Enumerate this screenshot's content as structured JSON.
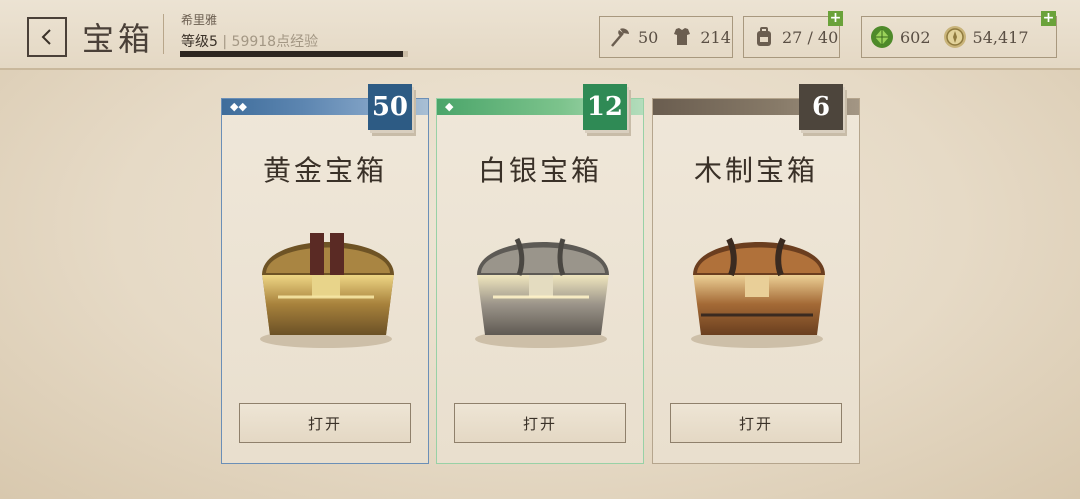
{
  "header": {
    "title": "宝箱",
    "player_name": "希里雅",
    "level": "等级5",
    "xp_text": "59918点经验",
    "xp_progress": 0.98
  },
  "resources": {
    "attack": "50",
    "armor": "214",
    "inventory": "27 / 40",
    "gems": "602",
    "coins": "54,417"
  },
  "chests": [
    {
      "name": "黄金宝箱",
      "count": "50",
      "tier_marks": "◆◆",
      "button": "打开",
      "accent": "#2d5b84"
    },
    {
      "name": "白银宝箱",
      "count": "12",
      "tier_marks": "◆",
      "button": "打开",
      "accent": "#2f8a55"
    },
    {
      "name": "木制宝箱",
      "count": "6",
      "tier_marks": "",
      "button": "打开",
      "accent": "#4d453c"
    }
  ]
}
